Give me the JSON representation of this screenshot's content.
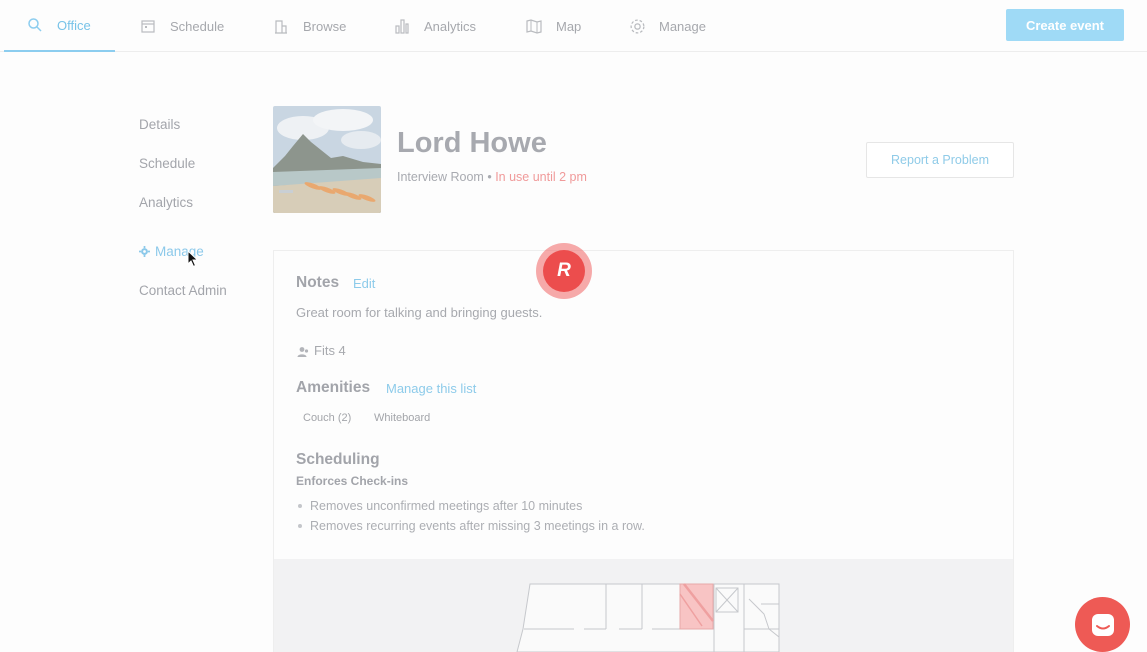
{
  "topnav": {
    "items": [
      {
        "label": "Office",
        "icon": "search-icon"
      },
      {
        "label": "Schedule",
        "icon": "calendar-icon"
      },
      {
        "label": "Browse",
        "icon": "building-icon"
      },
      {
        "label": "Analytics",
        "icon": "bar-chart-icon"
      },
      {
        "label": "Map",
        "icon": "map-icon"
      },
      {
        "label": "Manage",
        "icon": "gear-icon"
      }
    ],
    "active": "Office",
    "create_label": "Create event"
  },
  "sidebar": {
    "items": [
      {
        "label": "Details"
      },
      {
        "label": "Schedule"
      },
      {
        "label": "Analytics"
      },
      {
        "label": "Manage",
        "icon": "gear-icon"
      },
      {
        "label": "Contact Admin"
      }
    ],
    "active": "Manage"
  },
  "room": {
    "title": "Lord Howe",
    "type": "Interview Room",
    "separator": "•",
    "status": "In use until 2 pm",
    "report_label": "Report a Problem"
  },
  "notes": {
    "heading": "Notes",
    "edit_label": "Edit",
    "text": "Great room for talking and bringing guests.",
    "capacity": "Fits 4"
  },
  "amenities": {
    "heading": "Amenities",
    "manage_label": "Manage this list",
    "items": [
      "Couch (2)",
      "Whiteboard"
    ]
  },
  "scheduling": {
    "heading": "Scheduling",
    "subheading": "Enforces Check-ins",
    "rules": [
      "Removes unconfirmed meetings after 10 minutes",
      "Removes recurring events after missing 3 meetings in a row."
    ]
  },
  "overlay": {
    "badge_letter": "R"
  },
  "colors": {
    "accent": "#8ccdef",
    "status": "#f09a9a",
    "badge": "#ec4d4d",
    "chat": "#ee5a55"
  }
}
